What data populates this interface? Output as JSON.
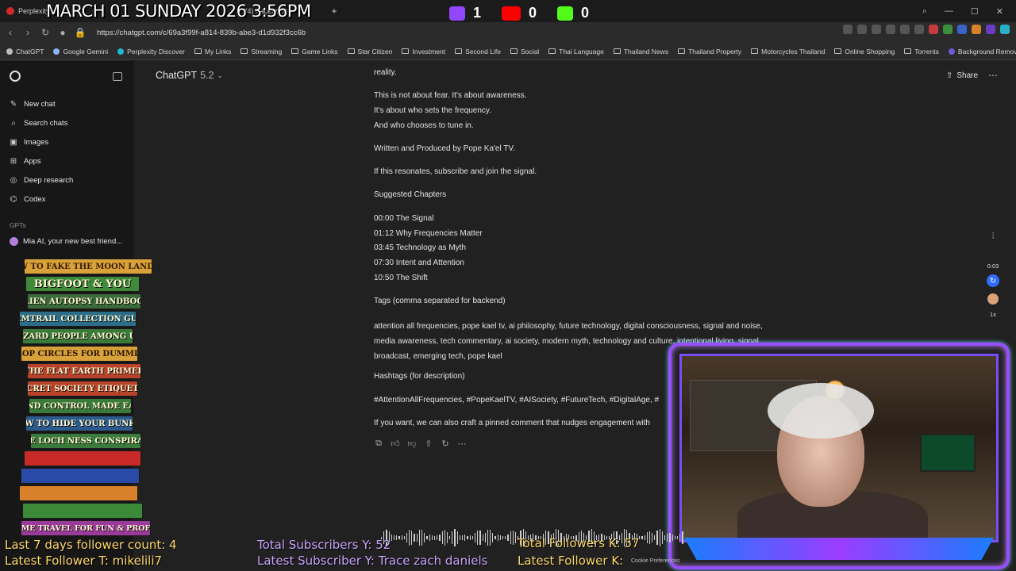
{
  "browser": {
    "tabs": [
      {
        "label": "Perplexity"
      },
      {
        "label": "(4) Facebook"
      }
    ],
    "url": "https://chatgpt.com/c/69a3f99f-a814-839b-abe3-d1d932f3cc6b",
    "bookmarks": [
      "ChatGPT",
      "Google Gemini",
      "Perplexity Discover",
      "My Links",
      "Streaming",
      "Game Links",
      "Star Citizen",
      "Investment",
      "Second Life",
      "Social",
      "Thai Language",
      "Thailand News",
      "Thailand Property",
      "Motorcycles Thailand",
      "Online Shopping",
      "Torrents",
      "Background Remover"
    ]
  },
  "overlay": {
    "title": "MARCH 01 SUNDAY 2026 3:56PM",
    "twitch_count": "1",
    "youtube_count": "0",
    "kick_count": "0",
    "followers_week": "Last 7 days follower count: 4",
    "latest_follower_t": "Latest Follower T: mikelili7",
    "total_subs_y": "Total Subscribers Y: 52",
    "latest_sub_y": "Latest Subscriber Y: Trace zach daniels",
    "total_followers_k": "Total Followers K: 57",
    "latest_follower_k": "Latest Follower K:",
    "books": [
      "HOW TO FAKE THE MOON LANDING",
      "BIGFOOT & YOU",
      "ALIEN AUTOPSY HANDBOOK",
      "CHEMTRAIL COLLECTION GUIDE",
      "LIZARD PEOPLE AMONG US",
      "CROP CIRCLES FOR DUMMIES",
      "THE FLAT EARTH PRIMER",
      "SECRET SOCIETY ETIQUETTE",
      "MIND CONTROL MADE EASY",
      "HOW TO HIDE YOUR BUNKER",
      "THE LOCH NESS CONSPIRACY",
      "",
      "",
      "",
      "",
      "",
      "TIME TRAVEL FOR FUN & PROFIT"
    ],
    "cookie_text": "Cookie Preferences"
  },
  "sidebar": {
    "items": [
      {
        "label": "New chat",
        "icon": "edit-icon"
      },
      {
        "label": "Search chats",
        "icon": "search-icon"
      },
      {
        "label": "Images",
        "icon": "image-icon"
      },
      {
        "label": "Apps",
        "icon": "apps-icon"
      },
      {
        "label": "Deep research",
        "icon": "research-icon"
      },
      {
        "label": "Codex",
        "icon": "codex-icon"
      }
    ],
    "gpts_label": "GPTs",
    "gpt_item": "Mia AI, your new best friend..."
  },
  "header": {
    "model": "ChatGPT",
    "version": "5.2",
    "share": "Share"
  },
  "message": {
    "reality": "reality.",
    "p1a": "This is not about fear. It's about awareness.",
    "p1b": "It's about who sets the frequency.",
    "p1c": "And who chooses to tune in.",
    "written": "Written and Produced by Pope Ka'el TV.",
    "resonates": "If this resonates, subscribe and join the signal.",
    "chapters_title": "Suggested Chapters",
    "chapters": [
      "00:00 The Signal",
      "01:12 Why Frequencies Matter",
      "03:45 Technology as Myth",
      "07:30 Intent and Attention",
      "10:50 The Shift"
    ],
    "tags_title": "Tags (comma separated for backend)",
    "tags": "attention all frequencies, pope kael tv, ai philosophy, future technology, digital consciousness, signal and noise, media awareness, tech commentary, ai society, modern myth, technology and culture, intentional living, signal broadcast, emerging tech, pope kael",
    "hashtags_title": "Hashtags (for description)",
    "hashtags": "#AttentionAllFrequencies, #PopeKaelTV, #AISociety, #FutureTech, #DigitalAge, #",
    "pinned": "If you want, we can also craft a pinned comment that nudges engagement with"
  },
  "rail": {
    "time": "0:03",
    "speed": "1x"
  },
  "colors": {
    "bg": "#212121",
    "sidebar": "#171717",
    "overlay_gold": "#ffd86a",
    "overlay_purple": "#c9a5ff",
    "frame": "#9a4dff"
  }
}
